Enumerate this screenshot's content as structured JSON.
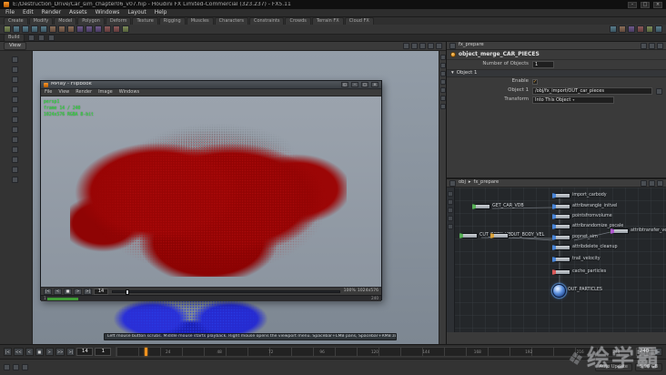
{
  "titlebar": {
    "title": "E:/Destruction_Drive/Car_sim_chapter06_v07.hip - Houdini FX Limited-Commercial (323.237) - FX5.11",
    "buttons": [
      "–",
      "□",
      "×"
    ]
  },
  "menubar": {
    "items": [
      "File",
      "Edit",
      "Render",
      "Assets",
      "Windows",
      "Layout",
      "Help"
    ]
  },
  "shelf": {
    "tabs": [
      "Create",
      "Modify",
      "Model",
      "Polygon",
      "Deform",
      "Texture",
      "Rigging",
      "Muscles",
      "Characters",
      "Constraints",
      "Crowds",
      "Terrain FX",
      "Cloud FX"
    ],
    "icon_names": [
      "select-arrow",
      "box",
      "sphere",
      "tube",
      "torus",
      "grid",
      "circle",
      "curve",
      "spray-paint",
      "metaball",
      "l-system",
      "platonic",
      "font",
      "null",
      "camera",
      "light",
      "bone",
      "paint",
      "sculpt",
      "dopnet"
    ]
  },
  "desktop": {
    "build_label": "Build"
  },
  "viewport": {
    "view_button": "View",
    "hint": "Left mouse button scrubs.  Middle mouse starts playback.  Right mouse opens the viewport menu.  Spacebar+LMB pans, Spacebar+RMB zooms, G frames the geometry."
  },
  "mplay": {
    "title": "MPlay - Flipbook",
    "window_buttons": [
      "◱",
      "–",
      "□",
      "×"
    ],
    "menus": [
      "File",
      "View",
      "Render",
      "Image",
      "Windows"
    ],
    "overlay_lines": [
      "persp1",
      "frame 14 / 240",
      "1024x576  RGBA 8-bit"
    ],
    "transport": [
      "|<",
      "<",
      "■",
      ">",
      ">|"
    ],
    "frame": "14",
    "zoom": "100%",
    "res": "1024x576",
    "range_start": "1",
    "range_end": "240"
  },
  "params": {
    "pane_title": "fx_prepare",
    "node_name": "object_merge_CAR_PIECES",
    "rows": {
      "num_label": "Number of Objects",
      "num_value": "1",
      "group_label": "Object 1",
      "enable_label": "Enable",
      "enable_check": "✓",
      "object_label": "Object 1",
      "object_value": "/obj/fx_import/OUT_car_pieces",
      "transform_label": "Transform",
      "transform_value": "Into This Object"
    }
  },
  "network": {
    "path": [
      "obj",
      "fx_prepare"
    ],
    "nodes": [
      {
        "name": "GET_CAR_VDB"
      },
      {
        "name": "CUT_BODY_VEL"
      },
      {
        "name": "OUT_BODY_VEL"
      },
      {
        "name": "import_carbody"
      },
      {
        "name": "attribwrangle_initvel"
      },
      {
        "name": "pointsfromvolume"
      },
      {
        "name": "attribrandomize_pscale"
      },
      {
        "name": "attribtransfer_vel"
      },
      {
        "name": "popnet_sim"
      },
      {
        "name": "attribdelete_cleanup"
      },
      {
        "name": "trail_velocity"
      },
      {
        "name": "cache_particles"
      },
      {
        "name": "OUT_PARTICLES"
      }
    ]
  },
  "playbar": {
    "transport": [
      "|<",
      "<<",
      "<",
      "■",
      ">",
      ">>",
      ">|"
    ],
    "current": "14",
    "start": "1",
    "end": "240",
    "ticks": [
      "24",
      "48",
      "72",
      "96",
      "120",
      "144",
      "168",
      "192",
      "216",
      "240"
    ]
  },
  "status": {
    "update_mode": "Auto Update",
    "memory": "5.96 GB"
  },
  "watermark": {
    "icon": "❖",
    "text": "绘学霸"
  }
}
